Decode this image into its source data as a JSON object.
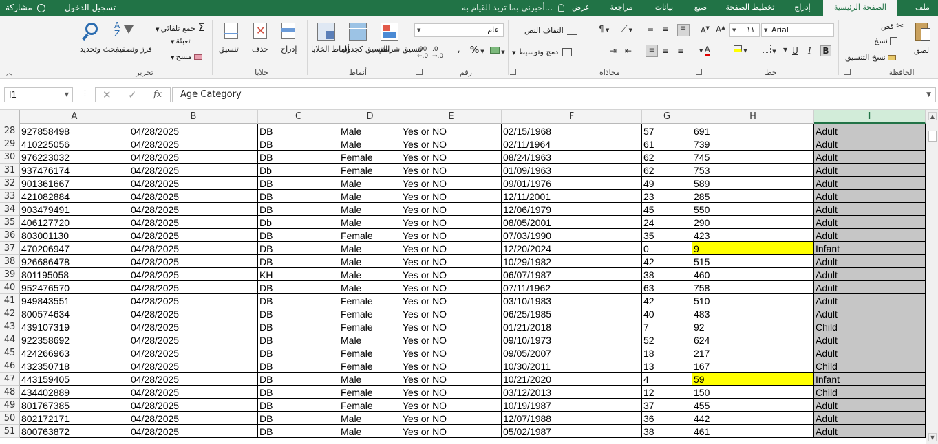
{
  "tabs": {
    "file": "ملف",
    "home": "الصفحة الرئيسية",
    "insert": "إدراج",
    "page_layout": "تخطيط الصفحة",
    "formulas": "صيغ",
    "data": "بيانات",
    "review": "مراجعة",
    "view": "عرض",
    "tell_me": "أخبرني بما تريد القيام به...",
    "sign_in": "تسجيل الدخول",
    "share": "مشاركة"
  },
  "ribbon": {
    "clipboard": {
      "label": "الحافظة",
      "paste": "لصق",
      "cut": "قص",
      "copy": "نسخ",
      "format_painter": "نسخ التنسيق"
    },
    "font": {
      "label": "خط",
      "name": "Arial",
      "size": "١١",
      "bold": "B",
      "italic": "I",
      "underline": "U"
    },
    "alignment": {
      "label": "محاذاة",
      "wrap_text": "التفاف النص",
      "merge_center": "دمج وتوسيط"
    },
    "number": {
      "label": "رقم",
      "format": "عام",
      "percent": "%",
      "comma": "،",
      "inc_decimal": ".00",
      "dec_decimal": ".0"
    },
    "styles": {
      "label": "أنماط",
      "conditional": "تنسيق شرطي",
      "format_table": "التنسيق كجدول",
      "cell_styles": "أنماط الخلايا"
    },
    "cells": {
      "label": "خلايا",
      "insert": "إدراج",
      "delete": "حذف",
      "format": "تنسيق"
    },
    "editing": {
      "label": "تحرير",
      "autosum": "جمع تلقائي",
      "fill": "تعبئة",
      "clear": "مسح",
      "sort_filter": "فرز وتصفية",
      "find_select": "بحث وتحديد"
    }
  },
  "formula_bar": {
    "name_box": "I1",
    "content": "Age Category"
  },
  "columns": [
    "A",
    "B",
    "C",
    "D",
    "E",
    "F",
    "G",
    "H",
    "I"
  ],
  "rows": [
    {
      "n": "28",
      "c": [
        "927858498",
        "04/28/2025",
        "DB",
        "Male",
        "Yes or NO",
        "02/15/1968",
        "57",
        "691",
        "Adult"
      ]
    },
    {
      "n": "29",
      "c": [
        "410225056",
        "04/28/2025",
        "DB",
        "Male",
        "Yes or NO",
        "02/11/1964",
        "61",
        "739",
        "Adult"
      ]
    },
    {
      "n": "30",
      "c": [
        "976223032",
        "04/28/2025",
        "DB",
        "Female",
        "Yes or NO",
        "08/24/1963",
        "62",
        "745",
        "Adult"
      ]
    },
    {
      "n": "31",
      "c": [
        "937476174",
        "04/28/2025",
        "Db",
        "Female",
        "Yes or NO",
        "01/09/1963",
        "62",
        "753",
        "Adult"
      ]
    },
    {
      "n": "32",
      "c": [
        "901361667",
        "04/28/2025",
        "DB",
        "Male",
        "Yes or NO",
        "09/01/1976",
        "49",
        "589",
        "Adult"
      ]
    },
    {
      "n": "33",
      "c": [
        "421082884",
        "04/28/2025",
        "DB",
        "Male",
        "Yes or NO",
        "12/11/2001",
        "23",
        "285",
        "Adult"
      ]
    },
    {
      "n": "34",
      "c": [
        "903479491",
        "04/28/2025",
        "DB",
        "Male",
        "Yes or NO",
        "12/06/1979",
        "45",
        "550",
        "Adult"
      ]
    },
    {
      "n": "35",
      "c": [
        "406127720",
        "04/28/2025",
        "Db",
        "Male",
        "Yes or NO",
        "08/05/2001",
        "24",
        "290",
        "Adult"
      ]
    },
    {
      "n": "36",
      "c": [
        "803001130",
        "04/28/2025",
        "DB",
        "Female",
        "Yes or NO",
        "07/03/1990",
        "35",
        "423",
        "Adult"
      ]
    },
    {
      "n": "37",
      "c": [
        "470206947",
        "04/28/2025",
        "DB",
        "Male",
        "Yes or NO",
        "12/20/2024",
        "0",
        "9",
        "Infant"
      ],
      "hl": true
    },
    {
      "n": "38",
      "c": [
        "926686478",
        "04/28/2025",
        "DB",
        "Male",
        "Yes or NO",
        "10/29/1982",
        "42",
        "515",
        "Adult"
      ]
    },
    {
      "n": "39",
      "c": [
        "801195058",
        "04/28/2025",
        "KH",
        "Male",
        "Yes or NO",
        "06/07/1987",
        "38",
        "460",
        "Adult"
      ]
    },
    {
      "n": "40",
      "c": [
        "952476570",
        "04/28/2025",
        "DB",
        "Male",
        "Yes or NO",
        "07/11/1962",
        "63",
        "758",
        "Adult"
      ]
    },
    {
      "n": "41",
      "c": [
        "949843551",
        "04/28/2025",
        "DB",
        "Female",
        "Yes or NO",
        "03/10/1983",
        "42",
        "510",
        "Adult"
      ]
    },
    {
      "n": "42",
      "c": [
        "800574634",
        "04/28/2025",
        "DB",
        "Female",
        "Yes or NO",
        "06/25/1985",
        "40",
        "483",
        "Adult"
      ]
    },
    {
      "n": "43",
      "c": [
        "439107319",
        "04/28/2025",
        "DB",
        "Female",
        "Yes or NO",
        "01/21/2018",
        "7",
        "92",
        "Child"
      ]
    },
    {
      "n": "44",
      "c": [
        "922358692",
        "04/28/2025",
        "DB",
        "Male",
        "Yes or NO",
        "09/10/1973",
        "52",
        "624",
        "Adult"
      ]
    },
    {
      "n": "45",
      "c": [
        "424266963",
        "04/28/2025",
        "DB",
        "Female",
        "Yes or NO",
        "09/05/2007",
        "18",
        "217",
        "Adult"
      ]
    },
    {
      "n": "46",
      "c": [
        "432350718",
        "04/28/2025",
        "DB",
        "Female",
        "Yes or NO",
        "10/30/2011",
        "13",
        "167",
        "Child"
      ]
    },
    {
      "n": "47",
      "c": [
        "443159405",
        "04/28/2025",
        "DB",
        "Male",
        "Yes or NO",
        "10/21/2020",
        "4",
        "59",
        "Infant"
      ],
      "hl": true
    },
    {
      "n": "48",
      "c": [
        "434402889",
        "04/28/2025",
        "DB",
        "Female",
        "Yes or NO",
        "03/12/2013",
        "12",
        "150",
        "Child"
      ]
    },
    {
      "n": "49",
      "c": [
        "801767385",
        "04/28/2025",
        "DB",
        "Female",
        "Yes or NO",
        "10/19/1987",
        "37",
        "455",
        "Adult"
      ]
    },
    {
      "n": "50",
      "c": [
        "802172171",
        "04/28/2025",
        "DB",
        "Male",
        "Yes or NO",
        "12/07/1988",
        "36",
        "442",
        "Adult"
      ]
    },
    {
      "n": "51",
      "c": [
        "800763872",
        "04/28/2025",
        "DB",
        "Male",
        "Yes or NO",
        "05/02/1987",
        "38",
        "461",
        "Adult"
      ]
    }
  ],
  "colors": {
    "accent": "#217346",
    "highlight": "#ffff00",
    "selected_column": "#c6c6c6"
  }
}
